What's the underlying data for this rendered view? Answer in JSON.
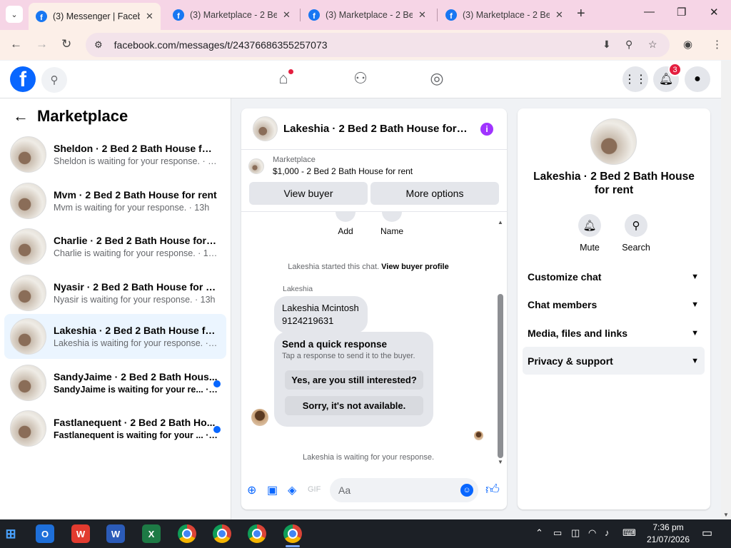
{
  "browser": {
    "tabs": [
      {
        "title": "(3) Messenger | Facebo",
        "active": true
      },
      {
        "title": "(3) Marketplace - 2 Bec",
        "active": false
      },
      {
        "title": "(3) Marketplace - 2 Bec",
        "active": false
      },
      {
        "title": "(3) Marketplace - 2 Bec",
        "active": false
      }
    ],
    "url": "facebook.com/messages/t/24376686355257073"
  },
  "header": {
    "notification_count": "3"
  },
  "sidebar": {
    "title": "Marketplace",
    "conversations": [
      {
        "name": "Sheldon · 2 Bed 2 Bath House for r...",
        "status": "Sheldon is waiting for your response. · 12h",
        "selected": false,
        "unread": false
      },
      {
        "name": "Mvm · 2 Bed 2 Bath House for rent",
        "status": "Mvm is waiting for your response. · 13h",
        "selected": false,
        "unread": false
      },
      {
        "name": "Charlie · 2 Bed 2 Bath House for rent",
        "status": "Charlie is waiting for your response. · 13h",
        "selected": false,
        "unread": false
      },
      {
        "name": "Nyasir · 2 Bed 2 Bath House for rent",
        "status": "Nyasir is waiting for your response. · 13h",
        "selected": false,
        "unread": false
      },
      {
        "name": "Lakeshia · 2 Bed 2 Bath House for ...",
        "status": "Lakeshia is waiting for your response. · 14h",
        "selected": true,
        "unread": false
      },
      {
        "name": "SandyJaime · 2 Bed 2 Bath Hous...",
        "status": "SandyJaime is waiting for your re... · 14h",
        "selected": false,
        "unread": true
      },
      {
        "name": "Fastlanequent · 2 Bed 2 Bath Ho...",
        "status": "Fastlanequent is waiting for your ... · 15h",
        "selected": false,
        "unread": true
      }
    ]
  },
  "chat": {
    "title": "Lakeshia · 2 Bed 2 Bath House for r...",
    "listing_source": "Marketplace",
    "listing_title": "$1,000 - 2 Bed 2 Bath House for rent",
    "view_buyer_label": "View buyer",
    "more_options_label": "More options",
    "add_label": "Add",
    "name_label": "Name",
    "started_text": "Lakeshia started this chat.",
    "view_profile_link": "View buyer profile",
    "sender": "Lakeshia",
    "message_line1": "Lakeshia Mcintosh",
    "message_line2": "9124219631",
    "quick_title": "Send a quick response",
    "quick_sub": "Tap a response to send it to the buyer.",
    "quick_reply_1": "Yes, are you still interested?",
    "quick_reply_2": "Sorry, it's not available.",
    "waiting_text": "Lakeshia is waiting for your response.",
    "input_placeholder": "Aa"
  },
  "info_panel": {
    "name": "Lakeshia · 2 Bed 2 Bath House for rent",
    "mute_label": "Mute",
    "search_label": "Search",
    "sections": [
      "Customize chat",
      "Chat members",
      "Media, files and links",
      "Privacy & support"
    ]
  },
  "taskbar": {
    "time": "7:36 pm",
    "date": "21/07/2026"
  },
  "colors": {
    "accent": "#0866ff",
    "selected_bg": "#ebf5ff",
    "tabstrip": "#f6d5e6"
  }
}
